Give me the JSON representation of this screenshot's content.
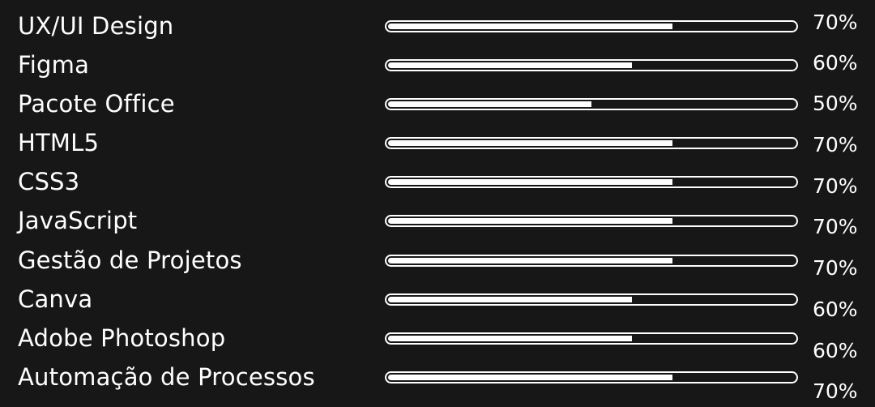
{
  "skills": [
    {
      "label": "UX/UI Design",
      "percent_text": "70%",
      "level": 0.7
    },
    {
      "label": "Figma",
      "percent_text": "60%",
      "level": 0.6
    },
    {
      "label": "Pacote Office",
      "percent_text": "50%",
      "level": 0.5
    },
    {
      "label": "HTML5",
      "percent_text": "70%",
      "level": 0.7
    },
    {
      "label": "CSS3",
      "percent_text": "70%",
      "level": 0.7
    },
    {
      "label": "JavaScript",
      "percent_text": "70%",
      "level": 0.7
    },
    {
      "label": "Gestão de Projetos",
      "percent_text": "70%",
      "level": 0.7
    },
    {
      "label": "Canva",
      "percent_text": "60%",
      "level": 0.6
    },
    {
      "label": "Adobe Photoshop",
      "percent_text": "60%",
      "level": 0.6
    },
    {
      "label": "Automação de Processos",
      "percent_text": "70%",
      "level": 0.7
    }
  ],
  "colors": {
    "background": "#171717",
    "foreground": "#ffffff"
  }
}
